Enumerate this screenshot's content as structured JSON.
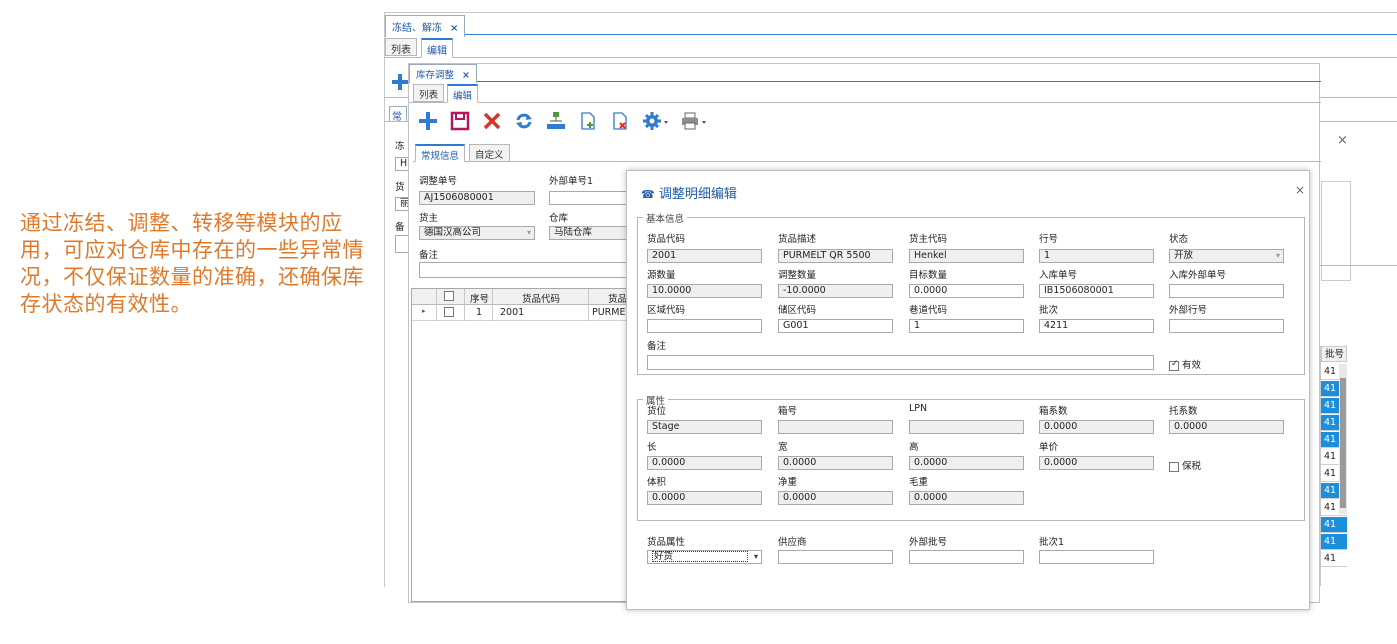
{
  "caption": "通过冻结、调整、转移等模块的应用，可应对仓库中存在的一些异常情况，不仅保证数量的准确，还确保库存状态的有效性。",
  "outer": {
    "tab_title": "冻结、解冻",
    "close_glyph": "×",
    "subtabs": [
      "列表",
      "编辑"
    ],
    "left_fragments": [
      "常",
      "冻",
      "HI",
      "货",
      "丽",
      "备"
    ],
    "dialog_close": "×"
  },
  "inner": {
    "tab_title": "库存调整",
    "close_glyph": "×",
    "subtabs": [
      "列表",
      "编辑"
    ],
    "form_tabs": [
      "常规信息",
      "自定义"
    ],
    "labels": {
      "adjust_no": "调整单号",
      "external_no": "外部单号1",
      "owner": "货主",
      "warehouse": "仓库",
      "remark": "备注"
    },
    "values": {
      "adjust_no": "AJ1506080001",
      "external_no": "",
      "owner": "德国汉高公司",
      "warehouse": "马陆仓库",
      "remark": ""
    },
    "grid": {
      "headers": [
        "序号",
        "货品代码",
        "货品"
      ],
      "rows": [
        {
          "seq": "1",
          "code": "2001",
          "desc": "PURMEL"
        }
      ]
    }
  },
  "dialog": {
    "title": "调整明细编辑",
    "close_glyph": "×",
    "basic_group": "基本信息",
    "attr_group": "属性",
    "labels": {
      "item_code": "货品代码",
      "item_desc": "货品描述",
      "owner_code": "货主代码",
      "line_no": "行号",
      "status": "状态",
      "src_qty": "源数量",
      "adj_qty": "调整数量",
      "target_qty": "目标数量",
      "inbound_no": "入库单号",
      "inbound_ext_no": "入库外部单号",
      "zone_code": "区域代码",
      "loc_code": "储区代码",
      "lane_code": "巷道代码",
      "batch": "批次",
      "ext_line_no": "外部行号",
      "remark": "备注",
      "valid": "有效",
      "position": "货位",
      "box_no": "箱号",
      "lpn": "LPN",
      "box_factor": "箱系数",
      "pallet_factor": "托系数",
      "length": "长",
      "width": "宽",
      "height": "高",
      "unit_price": "单价",
      "bonded": "保税",
      "volume": "体积",
      "net_weight": "净重",
      "gross_weight": "毛重",
      "item_attr": "货品属性",
      "supplier": "供应商",
      "ext_batch": "外部批号",
      "batch1": "批次1"
    },
    "values": {
      "item_code": "2001",
      "item_desc": "PURMELT QR 5500",
      "owner_code": "Henkel",
      "line_no": "1",
      "status": "开放",
      "src_qty": "10.0000",
      "adj_qty": "-10.0000",
      "target_qty": "0.0000",
      "inbound_no": "IB1506080001",
      "inbound_ext_no": "",
      "zone_code": "",
      "loc_code": "G001",
      "lane_code": "1",
      "batch": "4211",
      "ext_line_no": "",
      "remark": "",
      "position": "Stage",
      "box_no": "",
      "lpn": "",
      "box_factor": "0.0000",
      "pallet_factor": "0.0000",
      "length": "0.0000",
      "width": "0.0000",
      "height": "0.0000",
      "unit_price": "0.0000",
      "volume": "0.0000",
      "net_weight": "0.0000",
      "gross_weight": "0.0000",
      "item_attr": "好货",
      "supplier": "",
      "ext_batch": "",
      "batch1": ""
    },
    "valid_checked": true,
    "bonded_checked": false
  },
  "right_panel": {
    "header": "批号",
    "cells": [
      "41",
      "41",
      "41",
      "41",
      "41",
      "41",
      "41",
      "41",
      "41",
      "41",
      "41",
      "41"
    ],
    "selected": [
      false,
      true,
      true,
      true,
      true,
      false,
      false,
      true,
      false,
      true,
      true,
      false
    ]
  },
  "colors": {
    "caption": "#e07a2b",
    "accent": "#2e7bd0",
    "selected": "#1c8fdc",
    "delete_red": "#d9342b",
    "save_purple": "#b2175e",
    "green": "#4b9a3c"
  }
}
